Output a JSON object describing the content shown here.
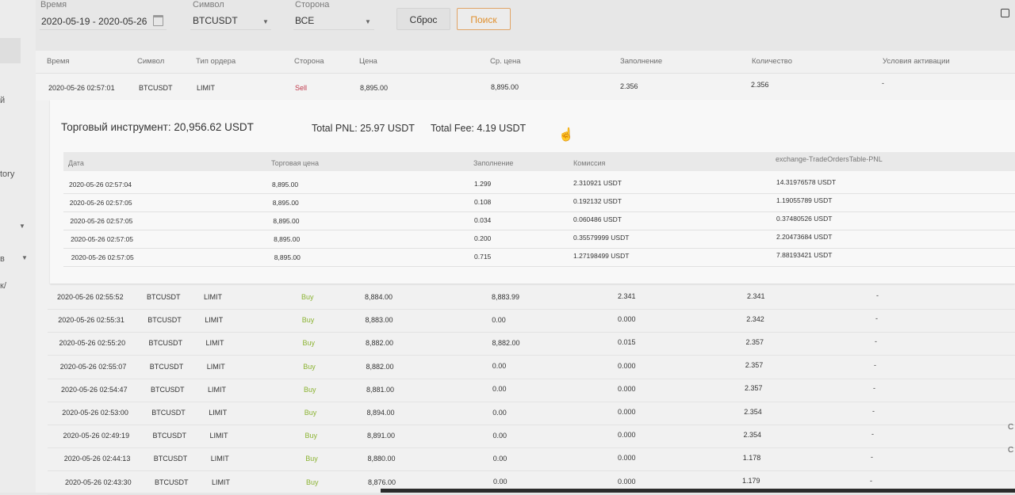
{
  "filters": {
    "time": {
      "label": "Время",
      "value": "2020-05-19 - 2020-05-26"
    },
    "symbol": {
      "label": "Символ",
      "value": "BTCUSDT"
    },
    "side": {
      "label": "Сторона",
      "value": "ВСЕ"
    },
    "reset_label": "Сброс",
    "search_label": "Поиск"
  },
  "sidebar_fragments": [
    "й",
    "tory",
    "в",
    "к/"
  ],
  "table": {
    "headers": [
      "Время",
      "Символ",
      "Тип ордера",
      "Сторона",
      "Цена",
      "Ср. цена",
      "Заполнение",
      "Количество",
      "Условия активации"
    ],
    "expanded_row": {
      "time": "2020-05-26 02:57:01",
      "symbol": "BTCUSDT",
      "type": "LIMIT",
      "side": "Sell",
      "price": "8,895.00",
      "avg_price": "8,895.00",
      "filled": "2.356",
      "quantity": "2.356",
      "trigger": "-"
    },
    "rows": [
      {
        "time": "2020-05-26 02:55:52",
        "symbol": "BTCUSDT",
        "type": "LIMIT",
        "side": "Buy",
        "price": "8,884.00",
        "avg_price": "8,883.99",
        "filled": "2.341",
        "quantity": "2.341",
        "trigger": "-"
      },
      {
        "time": "2020-05-26 02:55:31",
        "symbol": "BTCUSDT",
        "type": "LIMIT",
        "side": "Buy",
        "price": "8,883.00",
        "avg_price": "0.00",
        "filled": "0.000",
        "quantity": "2.342",
        "trigger": "-"
      },
      {
        "time": "2020-05-26 02:55:20",
        "symbol": "BTCUSDT",
        "type": "LIMIT",
        "side": "Buy",
        "price": "8,882.00",
        "avg_price": "8,882.00",
        "filled": "0.015",
        "quantity": "2.357",
        "trigger": "-"
      },
      {
        "time": "2020-05-26 02:55:07",
        "symbol": "BTCUSDT",
        "type": "LIMIT",
        "side": "Buy",
        "price": "8,882.00",
        "avg_price": "0.00",
        "filled": "0.000",
        "quantity": "2.357",
        "trigger": "-"
      },
      {
        "time": "2020-05-26 02:54:47",
        "symbol": "BTCUSDT",
        "type": "LIMIT",
        "side": "Buy",
        "price": "8,881.00",
        "avg_price": "0.00",
        "filled": "0.000",
        "quantity": "2.357",
        "trigger": "-"
      },
      {
        "time": "2020-05-26 02:53:00",
        "symbol": "BTCUSDT",
        "type": "LIMIT",
        "side": "Buy",
        "price": "8,894.00",
        "avg_price": "0.00",
        "filled": "0.000",
        "quantity": "2.354",
        "trigger": "-"
      },
      {
        "time": "2020-05-26 02:49:19",
        "symbol": "BTCUSDT",
        "type": "LIMIT",
        "side": "Buy",
        "price": "8,891.00",
        "avg_price": "0.00",
        "filled": "0.000",
        "quantity": "2.354",
        "trigger": "-"
      },
      {
        "time": "2020-05-26 02:44:13",
        "symbol": "BTCUSDT",
        "type": "LIMIT",
        "side": "Buy",
        "price": "8,880.00",
        "avg_price": "0.00",
        "filled": "0.000",
        "quantity": "1.178",
        "trigger": "-"
      },
      {
        "time": "2020-05-26 02:43:30",
        "symbol": "BTCUSDT",
        "type": "LIMIT",
        "side": "Buy",
        "price": "8,876.00",
        "avg_price": "0.00",
        "filled": "0.000",
        "quantity": "1.179",
        "trigger": "-"
      }
    ]
  },
  "detail": {
    "instrument_label": "Торговый инструмент: 20,956.62 USDT",
    "total_pnl": "Total PNL: 25.97 USDT",
    "total_fee": "Total Fee: 4.19 USDT",
    "headers": [
      "Дата",
      "Торговая цена",
      "Заполнение",
      "Комиссия",
      "exchange-TradeOrdersTable-PNL"
    ],
    "trades": [
      {
        "date": "2020-05-26 02:57:04",
        "price": "8,895.00",
        "filled": "1.299",
        "fee": "2.310921 USDT",
        "pnl": "14.31976578 USDT"
      },
      {
        "date": "2020-05-26 02:57:05",
        "price": "8,895.00",
        "filled": "0.108",
        "fee": "0.192132 USDT",
        "pnl": "1.19055789 USDT"
      },
      {
        "date": "2020-05-26 02:57:05",
        "price": "8,895.00",
        "filled": "0.034",
        "fee": "0.060486 USDT",
        "pnl": "0.37480526 USDT"
      },
      {
        "date": "2020-05-26 02:57:05",
        "price": "8,895.00",
        "filled": "0.200",
        "fee": "0.35579999 USDT",
        "pnl": "2.20473684 USDT"
      },
      {
        "date": "2020-05-26 02:57:05",
        "price": "8,895.00",
        "filled": "0.715",
        "fee": "1.27198499 USDT",
        "pnl": "7.88193421 USDT"
      }
    ]
  },
  "colors": {
    "sell": "#c0394b",
    "buy": "#8bb332",
    "accent": "#e0902e"
  }
}
